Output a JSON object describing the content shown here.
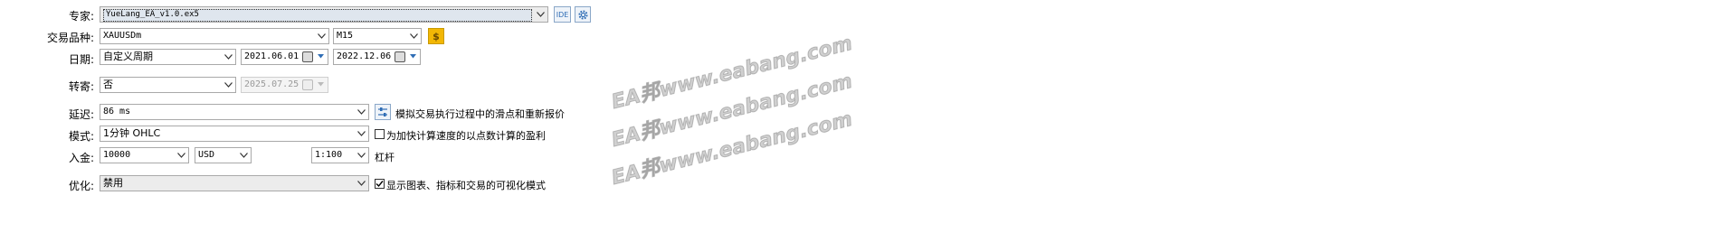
{
  "labels": {
    "expert": "专家:",
    "symbol": "交易品种:",
    "date": "日期:",
    "forward": "转寄:",
    "delay": "延迟:",
    "model": "模式:",
    "deposit": "入金:",
    "optimization": "优化:"
  },
  "expert": {
    "value": "YueLang_EA_v1.0.ex5",
    "ide_label": "IDE"
  },
  "symbol": {
    "value": "XAUUSDm",
    "timeframe": "M15"
  },
  "date": {
    "period": "自定义周期",
    "from": "2021.06.01",
    "to": "2022.12.06"
  },
  "forward": {
    "value": "否",
    "date": "2025.07.25"
  },
  "delay": {
    "value": "86 ms",
    "option_text": "模拟交易执行过程中的滑点和重新报价"
  },
  "model": {
    "value": "1分钟 OHLC",
    "option_text": "为加快计算速度的以点数计算的盈利",
    "option_checked": false
  },
  "deposit": {
    "amount": "10000",
    "currency": "USD",
    "leverage": "1:100",
    "leverage_label": "杠杆"
  },
  "optimization": {
    "value": "禁用",
    "option_text": "显示图表、指标和交易的可视化模式",
    "option_checked": true
  },
  "watermark": "EA邦www.eabang.com",
  "colors": {
    "field_border": "#a9a9a9",
    "accent": "#2f6db5",
    "gold_icon": "#f2b705"
  }
}
